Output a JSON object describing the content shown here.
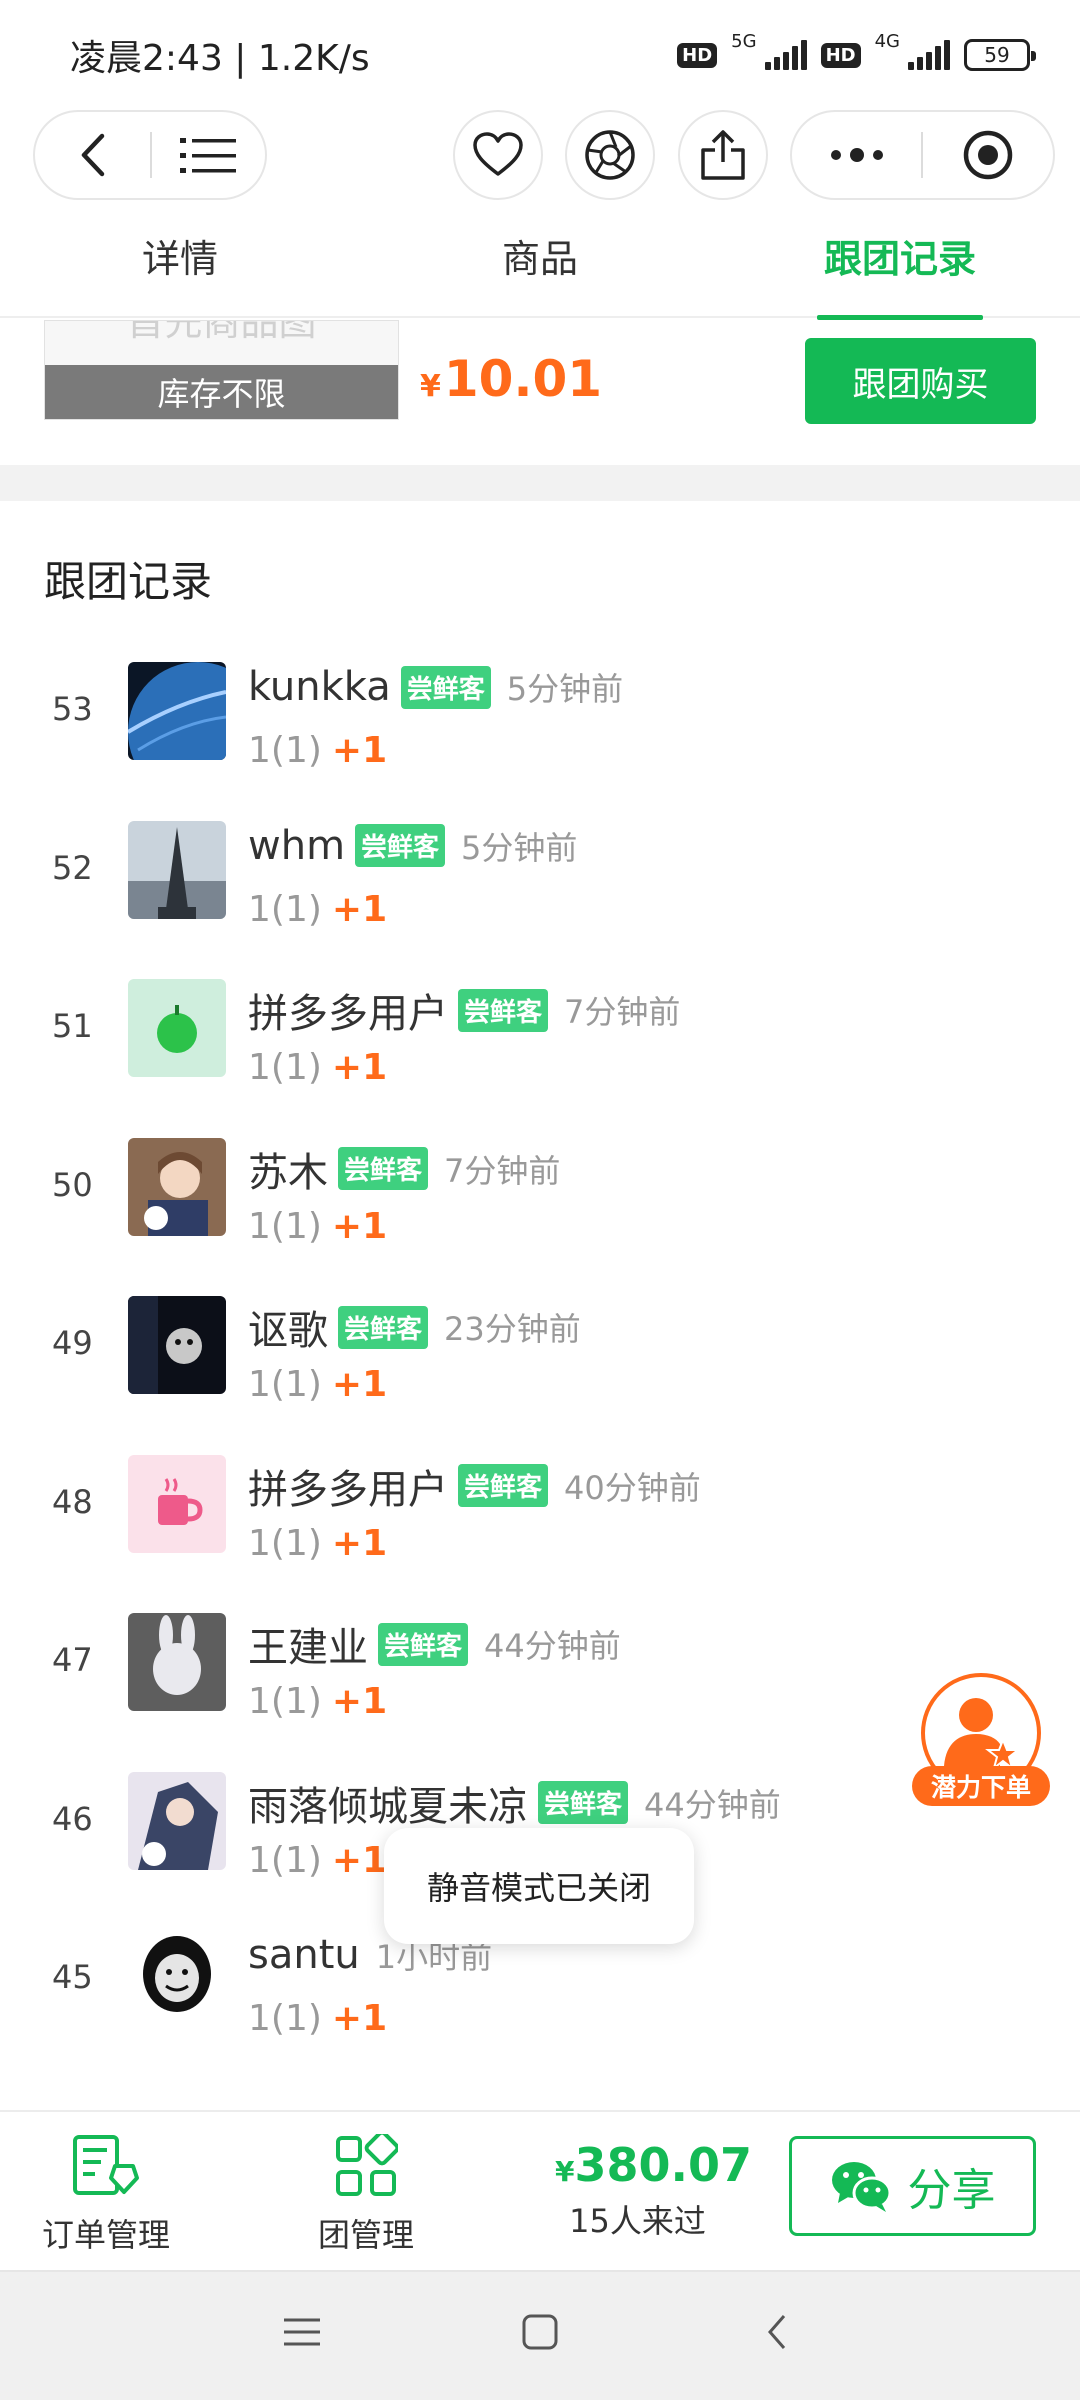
{
  "status_bar": {
    "time_speed": "凌晨2:43 | 1.2K/s",
    "hd1": "HD",
    "net1": "5G",
    "hd2": "HD",
    "net2": "4G",
    "battery": "59"
  },
  "nav": {
    "back_icon": "chevron-left-icon",
    "menu_icon": "list-menu-icon",
    "favorite_icon": "heart-icon",
    "camera_icon": "aperture-icon",
    "share_icon": "share-upload-icon",
    "more_icon": "more-dots-icon",
    "close_icon": "target-close-icon"
  },
  "tabs": [
    {
      "label": "详情",
      "active": false
    },
    {
      "label": "商品",
      "active": false
    },
    {
      "label": "跟团记录",
      "active": true
    }
  ],
  "product": {
    "ghost_text": "首先商品图",
    "stock": "库存不限",
    "price_symbol": "¥",
    "price": "10.01",
    "join_button": "跟团购买"
  },
  "records": {
    "title": "跟团记录",
    "items": [
      {
        "num": "53",
        "name": "kunkka",
        "tag": "尝鲜客",
        "time": "5分钟前",
        "qty": "1(1)",
        "plus": "+1",
        "avatar": "planet"
      },
      {
        "num": "52",
        "name": "whm",
        "tag": "尝鲜客",
        "time": "5分钟前",
        "qty": "1(1)",
        "plus": "+1",
        "avatar": "tower"
      },
      {
        "num": "51",
        "name": "拼多多用户",
        "tag": "尝鲜客",
        "time": "7分钟前",
        "qty": "1(1)",
        "plus": "+1",
        "avatar": "apple"
      },
      {
        "num": "50",
        "name": "苏木",
        "tag": "尝鲜客",
        "time": "7分钟前",
        "qty": "1(1)",
        "plus": "+1",
        "avatar": "anime"
      },
      {
        "num": "49",
        "name": "讴歌",
        "tag": "尝鲜客",
        "time": "23分钟前",
        "qty": "1(1)",
        "plus": "+1",
        "avatar": "dark"
      },
      {
        "num": "48",
        "name": "拼多多用户",
        "tag": "尝鲜客",
        "time": "40分钟前",
        "qty": "1(1)",
        "plus": "+1",
        "avatar": "cup"
      },
      {
        "num": "47",
        "name": "王建业",
        "tag": "尝鲜客",
        "time": "44分钟前",
        "qty": "1(1)",
        "plus": "+1",
        "avatar": "rabbit"
      },
      {
        "num": "46",
        "name": "雨落倾城夏未凉",
        "tag": "尝鲜客",
        "time": "44分钟前",
        "qty": "1(1)",
        "plus": "+1",
        "avatar": "art"
      },
      {
        "num": "45",
        "name": "santu",
        "tag": "",
        "time": "1小时前",
        "qty": "1(1)",
        "plus": "+1",
        "avatar": "meme"
      }
    ]
  },
  "floating": {
    "badge_label": "潜力下单",
    "toast": "静音模式已关闭"
  },
  "bottom_bar": {
    "orders_label": "订单管理",
    "groups_label": "团管理",
    "total_symbol": "¥",
    "total": "380.07",
    "visits": "15人来过",
    "share_label": "分享"
  },
  "colors": {
    "accent_green": "#14b955",
    "price_orange": "#ff6a1a",
    "tag_green": "#3fd07f"
  }
}
